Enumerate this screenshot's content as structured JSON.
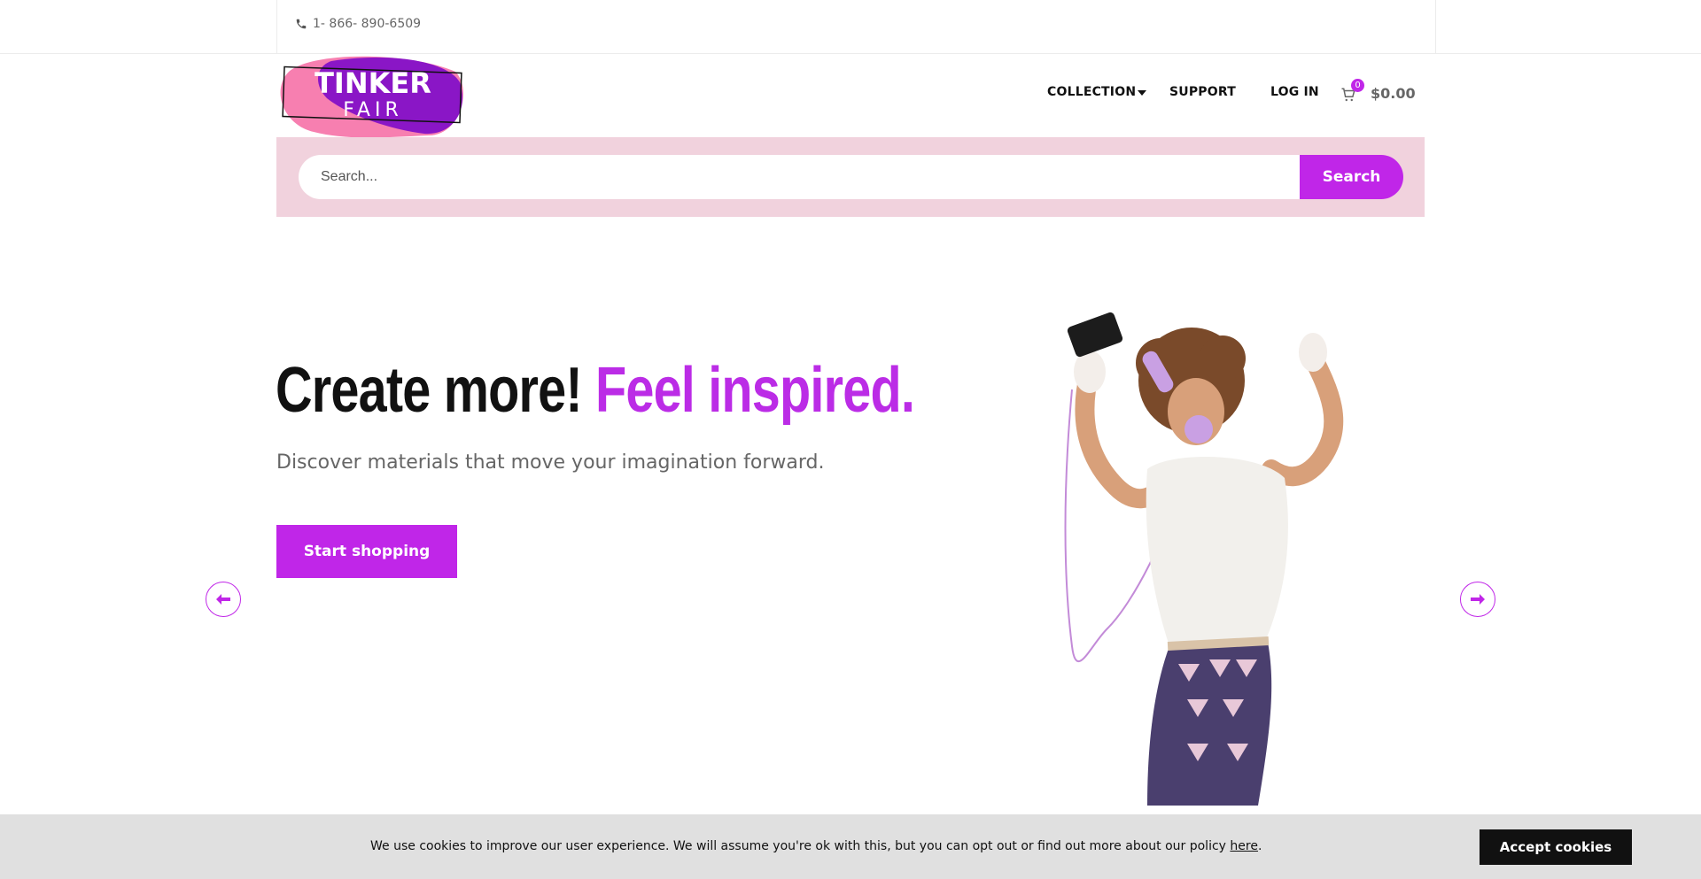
{
  "topbar": {
    "phone": "1- 866- 890-6509",
    "phone_icon": "phone-icon"
  },
  "brand": {
    "line1": "TINKER",
    "line2": "FAIR",
    "colors": {
      "pink": "#f77fb0",
      "purple": "#8a16c6"
    }
  },
  "nav": {
    "collection": "COLLECTION",
    "support": "SUPPORT",
    "login": "LOG IN"
  },
  "cart": {
    "count": "0",
    "total": "$0.00",
    "icon": "cart-icon"
  },
  "search": {
    "placeholder": "Search...",
    "button": "Search"
  },
  "hero": {
    "title_part1": "Create more!",
    "title_part2": "Feel inspired.",
    "subtitle": "Discover materials that move your imagination forward.",
    "cta": "Start shopping",
    "prev_icon": "arrow-left-icon",
    "next_icon": "arrow-right-icon"
  },
  "cookie": {
    "text": "We use cookies to improve our user experience. We will assume you're ok with this, but you can opt out or find out more about our policy",
    "link": "here",
    "suffix": ".",
    "button": "Accept cookies"
  },
  "colors": {
    "accent": "#c026e8",
    "search_band": "#f1d2dd",
    "cookie_bar": "#e0e0e0"
  }
}
